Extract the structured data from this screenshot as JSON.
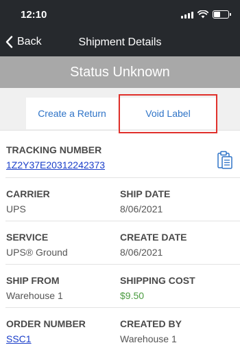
{
  "status_bar": {
    "time": "12:10"
  },
  "nav": {
    "back_label": "Back",
    "title": "Shipment Details"
  },
  "status": {
    "text": "Status Unknown"
  },
  "actions": {
    "create_return": "Create a Return",
    "void_label": "Void Label"
  },
  "details": {
    "tracking_number": {
      "label": "TRACKING NUMBER",
      "value": "1Z2Y37E20312242373"
    },
    "carrier": {
      "label": "CARRIER",
      "value": "UPS"
    },
    "ship_date": {
      "label": "SHIP DATE",
      "value": "8/06/2021"
    },
    "service": {
      "label": "SERVICE",
      "value": "UPS® Ground"
    },
    "create_date": {
      "label": "CREATE DATE",
      "value": "8/06/2021"
    },
    "ship_from": {
      "label": "SHIP FROM",
      "value": "Warehouse 1"
    },
    "shipping_cost": {
      "label": "SHIPPING COST",
      "value": "$9.50"
    },
    "order_number": {
      "label": "ORDER NUMBER",
      "value": "SSC1"
    },
    "created_by": {
      "label": "CREATED BY",
      "value": "Warehouse 1"
    }
  },
  "icons": {
    "back": "chevron-left-icon",
    "copy": "clipboard-icon",
    "signal": "cellular-signal-icon",
    "wifi": "wifi-icon",
    "battery": "battery-icon"
  },
  "colors": {
    "header_bg": "#26292d",
    "status_banner_bg": "#a8a8a8",
    "action_text": "#2e73c7",
    "link": "#1a3ec9",
    "cost": "#4a9b3f",
    "highlight": "#e0302b"
  }
}
